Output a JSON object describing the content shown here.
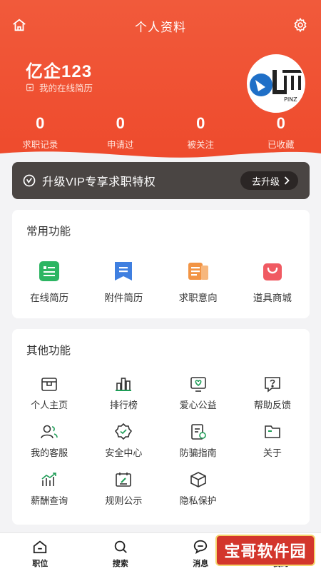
{
  "header": {
    "title": "个人资料",
    "username": "亿企123",
    "resume_link": "我的在线简历",
    "avatar_text": "PINZ"
  },
  "stats": [
    {
      "value": "0",
      "label": "求职记录"
    },
    {
      "value": "0",
      "label": "申请过"
    },
    {
      "value": "0",
      "label": "被关注"
    },
    {
      "value": "0",
      "label": "已收藏"
    }
  ],
  "vip": {
    "text": "升级VIP专享求职特权",
    "button": "去升级",
    "button_icon": "chevron-right-icon"
  },
  "common": {
    "title": "常用功能",
    "items": [
      {
        "label": "在线简历",
        "icon": "resume-icon",
        "color": "#2cb562"
      },
      {
        "label": "附件简历",
        "icon": "attachment-icon",
        "color": "#3f7fe0"
      },
      {
        "label": "求职意向",
        "icon": "intent-icon",
        "color": "#f29444"
      },
      {
        "label": "道具商城",
        "icon": "shop-bag-icon",
        "color": "#f05a62"
      }
    ]
  },
  "other": {
    "title": "其他功能",
    "items": [
      {
        "label": "个人主页",
        "icon": "home-page-icon"
      },
      {
        "label": "排行榜",
        "icon": "ranking-icon"
      },
      {
        "label": "爱心公益",
        "icon": "heart-icon"
      },
      {
        "label": "帮助反馈",
        "icon": "help-icon"
      },
      {
        "label": "我的客服",
        "icon": "customer-service-icon"
      },
      {
        "label": "安全中心",
        "icon": "security-icon"
      },
      {
        "label": "防骗指南",
        "icon": "guide-icon"
      },
      {
        "label": "关于",
        "icon": "folder-icon"
      },
      {
        "label": "薪酬查询",
        "icon": "salary-chart-icon"
      },
      {
        "label": "规则公示",
        "icon": "rules-icon"
      },
      {
        "label": "隐私保护",
        "icon": "privacy-box-icon"
      }
    ]
  },
  "bottom_nav": [
    {
      "label": "职位",
      "icon": "home-icon"
    },
    {
      "label": "搜索",
      "icon": "search-icon"
    },
    {
      "label": "消息",
      "icon": "message-icon"
    },
    {
      "label": "我的",
      "icon": "profile-icon"
    }
  ],
  "watermark": "宝哥软件园",
  "colors": {
    "brand": "#ee4a2c",
    "green_icon": "#1e9d57",
    "vip_bg": "#4a4543"
  }
}
